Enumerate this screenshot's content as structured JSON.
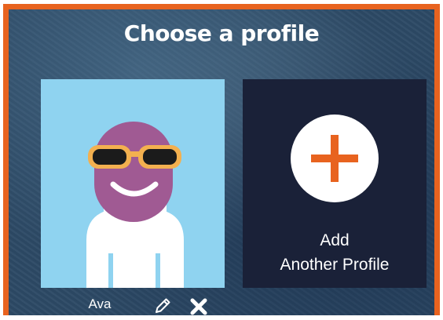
{
  "page": {
    "title": "Choose a profile"
  },
  "profiles": [
    {
      "name": "Ava",
      "avatar": "purple-face-with-sunglasses"
    }
  ],
  "add_profile": {
    "line1": "Add",
    "line2": "Another Profile",
    "icon": "plus-icon"
  },
  "profile_actions": {
    "edit_icon": "pencil-icon",
    "delete_icon": "close-icon"
  },
  "colors": {
    "frame_border": "#e8631f",
    "background": "#2d4a66",
    "avatar_bg": "#8fd3f0",
    "avatar_face": "#a05a93",
    "sunglasses_frame": "#f3b04f",
    "add_card_bg": "#1a2138",
    "plus": "#e8631f"
  }
}
